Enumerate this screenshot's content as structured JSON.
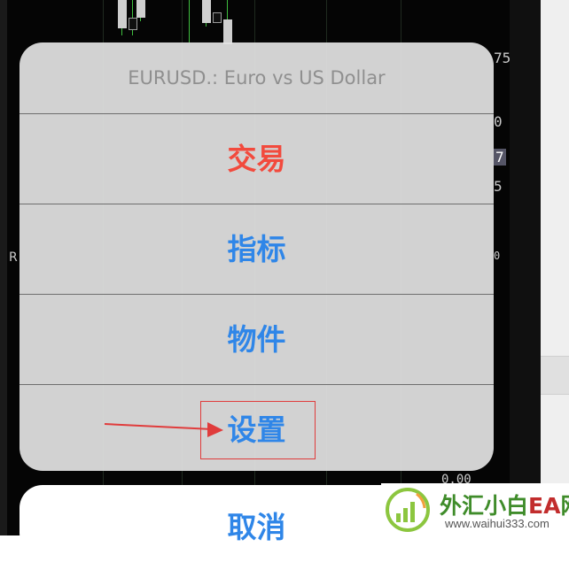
{
  "background": {
    "price_ticks": [
      "75",
      "0",
      "7",
      "5",
      "0"
    ],
    "left_label": "R",
    "bottom_value": "0.00"
  },
  "action_sheet": {
    "title": "EURUSD.: Euro vs US Dollar",
    "items": [
      {
        "label": "交易",
        "style": "destructive",
        "color": "#f24a3d"
      },
      {
        "label": "指标",
        "style": "default",
        "color": "#2f86e8"
      },
      {
        "label": "物件",
        "style": "default",
        "color": "#2f86e8"
      },
      {
        "label": "设置",
        "style": "default",
        "color": "#2f86e8"
      }
    ],
    "cancel_label": "取消"
  },
  "annotation": {
    "target": "设置",
    "color": "#e03c3c"
  },
  "watermark": {
    "title_cn": "外汇小白",
    "title_ea": "EA",
    "title_tail": "网",
    "url": "www.waihui333.com"
  }
}
